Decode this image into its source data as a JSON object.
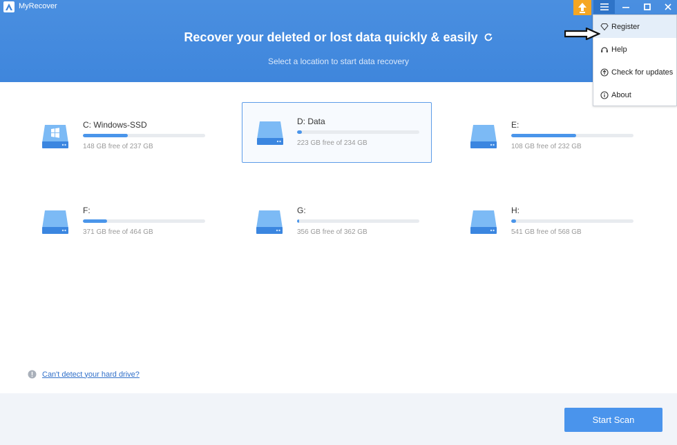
{
  "app": {
    "title": "MyRecover"
  },
  "header": {
    "title": "Recover your deleted or lost data quickly & easily",
    "subtitle": "Select a location to start data recovery"
  },
  "menu": {
    "items": [
      {
        "label": "Register",
        "icon": "diamond-icon"
      },
      {
        "label": "Help",
        "icon": "headset-icon"
      },
      {
        "label": "Check for updates",
        "icon": "upload-circle-icon"
      },
      {
        "label": "About",
        "icon": "info-icon"
      }
    ]
  },
  "drives": [
    {
      "name": "C: Windows-SSD",
      "free": "148 GB free of 237 GB",
      "used_fraction": 0.37,
      "icon": "windows-drive-icon"
    },
    {
      "name": "D: Data",
      "free": "223 GB free of 234 GB",
      "used_fraction": 0.04,
      "selected": true,
      "icon": "drive-icon"
    },
    {
      "name": "E:",
      "free": "108 GB free of 232 GB",
      "used_fraction": 0.53,
      "icon": "drive-icon"
    },
    {
      "name": "F:",
      "free": "371 GB free of 464 GB",
      "used_fraction": 0.2,
      "icon": "drive-icon"
    },
    {
      "name": "G:",
      "free": "356 GB free of 362 GB",
      "used_fraction": 0.015,
      "icon": "drive-icon"
    },
    {
      "name": "H:",
      "free": "541 GB free of 568 GB",
      "used_fraction": 0.04,
      "icon": "drive-icon"
    }
  ],
  "help_link": "Can't detect your hard drive?",
  "start_scan": "Start Scan",
  "colors": {
    "header": "#4a8fe0",
    "accent": "#4a94ec",
    "upgrade": "#f5a623"
  }
}
